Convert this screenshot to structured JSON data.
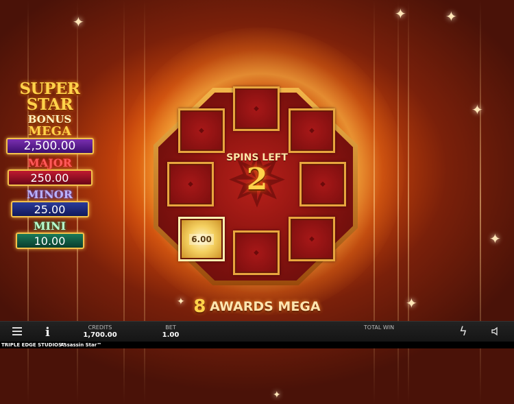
{
  "jackpot": {
    "title_line1": "SUPER STAR",
    "title_line2": "BONUS",
    "tiers": [
      {
        "label": "MEGA",
        "value": "2,500.00"
      },
      {
        "label": "MAJOR",
        "value": "250.00"
      },
      {
        "label": "MINOR",
        "value": "25.00"
      },
      {
        "label": "MINI",
        "value": "10.00"
      }
    ]
  },
  "board": {
    "spins_label": "SPINS LEFT",
    "spins_count": "2",
    "win_cell_value": "6.00"
  },
  "awards": {
    "count": "8",
    "text": "AWARDS MEGA"
  },
  "bar": {
    "credits_label": "CREDITS",
    "credits_value": "1,700.00",
    "bet_label": "BET",
    "bet_value": "1.00",
    "total_win_label": "TOTAL WIN"
  },
  "brand": {
    "studio": "TRIPLE EDGE STUDIOS™",
    "game": "Assassin Star™"
  },
  "icons": [
    "menu-icon",
    "info-icon",
    "bolt-icon",
    "speaker-icon",
    "shuriken-icon",
    "sparkle-icon"
  ],
  "colors": {
    "accent_gold": "#ffd24a",
    "mega": "#5a1e90",
    "major": "#a0142a",
    "minor": "#1e2a80",
    "mini": "#125a42"
  }
}
